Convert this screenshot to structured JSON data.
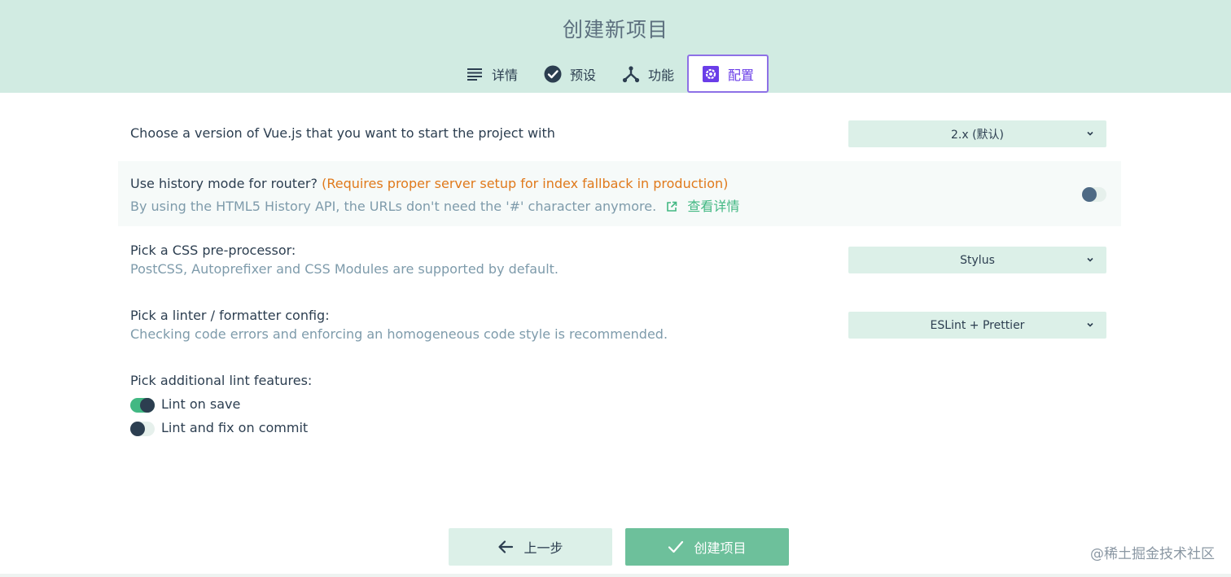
{
  "title": "创建新项目",
  "tabs": [
    {
      "label": "详情",
      "icon": "list-icon",
      "active": false
    },
    {
      "label": "预设",
      "icon": "check-circle-icon",
      "active": false
    },
    {
      "label": "功能",
      "icon": "fork-icon",
      "active": false
    },
    {
      "label": "配置",
      "icon": "settings-icon",
      "active": true
    }
  ],
  "options": {
    "vue_version": {
      "label": "Choose a version of Vue.js that you want to start the project with",
      "value": "2.x (默认)"
    },
    "history_mode": {
      "label": "Use history mode for router?",
      "warning": "(Requires proper server setup for index fallback in production)",
      "description": "By using the HTML5 History API, the URLs don't need the '#' character anymore.",
      "more_link": "查看详情",
      "enabled": false
    },
    "css_preprocessor": {
      "label": "Pick a CSS pre-processor:",
      "description": "PostCSS, Autoprefixer and CSS Modules are supported by default.",
      "value": "Stylus"
    },
    "linter": {
      "label": "Pick a linter / formatter config:",
      "description": "Checking code errors and enforcing an homogeneous code style is recommended.",
      "value": "ESLint + Prettier"
    },
    "lint_features": {
      "label": "Pick additional lint features:",
      "items": [
        {
          "label": "Lint on save",
          "checked": true
        },
        {
          "label": "Lint and fix on commit",
          "checked": false
        }
      ]
    }
  },
  "footer": {
    "prev_label": "上一步",
    "create_label": "创建项目"
  },
  "watermark": "@稀土掘金技术社区",
  "colors": {
    "header_bg": "#d1ebe2",
    "accent": "#42b883",
    "active_tab": "#6a3de8",
    "warning": "#e0791b"
  }
}
